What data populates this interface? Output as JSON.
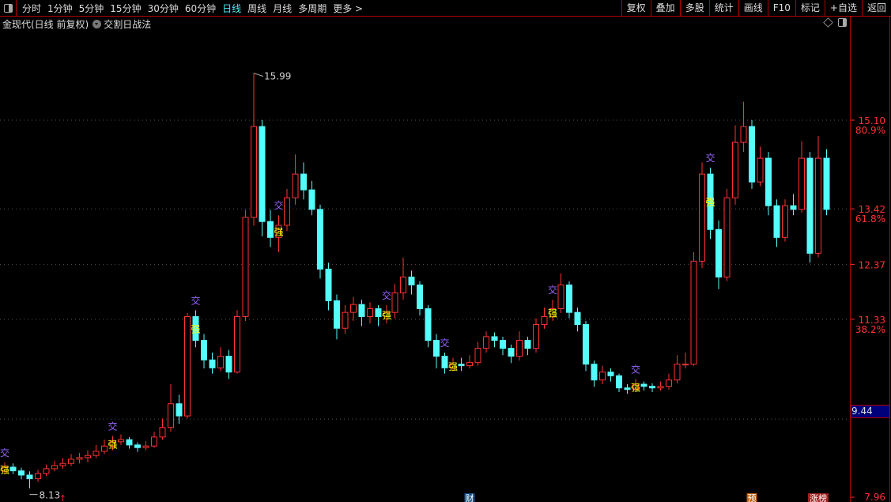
{
  "toolbar": {
    "periods": [
      "分时",
      "1分钟",
      "5分钟",
      "15分钟",
      "30分钟",
      "60分钟",
      "日线",
      "周线",
      "月线",
      "多周期",
      "更多 >"
    ],
    "active_period": "日线",
    "tools": [
      "复权",
      "叠加",
      "多股",
      "统计",
      "画线",
      "F10",
      "标记",
      "+自选",
      "返回"
    ]
  },
  "subbar": {
    "title": "金现代(日线 前复权)",
    "indicator": "交割日战法"
  },
  "colors": {
    "up": "#ff3232",
    "down": "#54fcfc",
    "signal_jiao": "#9966ff",
    "signal_qiang": "#ffff00",
    "axis": "#ff3232",
    "current_box": "#00007a",
    "active": "#4cf0f6"
  },
  "chart_data": {
    "type": "candlestick",
    "ylim": [
      7.96,
      15.99
    ],
    "y_ticks": [
      {
        "price": "15.10",
        "pct": "80.9%"
      },
      {
        "price": "13.42",
        "pct": "61.8%"
      },
      {
        "price": "12.37",
        "pct": ""
      },
      {
        "price": "11.33",
        "pct": "38.2%"
      },
      {
        "price": "7.96",
        "pct": ""
      }
    ],
    "current_price": "9.44",
    "max_label": "15.99",
    "min_label": "8.13",
    "ohlc": [
      [
        8.45,
        8.62,
        8.4,
        8.53
      ],
      [
        8.53,
        8.6,
        8.4,
        8.46
      ],
      [
        8.46,
        8.52,
        8.3,
        8.38
      ],
      [
        8.38,
        8.45,
        8.13,
        8.31
      ],
      [
        8.31,
        8.48,
        8.25,
        8.41
      ],
      [
        8.41,
        8.58,
        8.36,
        8.5
      ],
      [
        8.5,
        8.65,
        8.45,
        8.56
      ],
      [
        8.56,
        8.7,
        8.5,
        8.6
      ],
      [
        8.6,
        8.78,
        8.55,
        8.68
      ],
      [
        8.68,
        8.8,
        8.6,
        8.71
      ],
      [
        8.71,
        8.85,
        8.62,
        8.75
      ],
      [
        8.75,
        8.95,
        8.7,
        8.83
      ],
      [
        8.83,
        9.05,
        8.78,
        8.93
      ],
      [
        8.93,
        9.12,
        8.85,
        9.01
      ],
      [
        9.01,
        9.15,
        8.95,
        9.05
      ],
      [
        9.05,
        9.1,
        8.88,
        8.95
      ],
      [
        8.95,
        9.0,
        8.82,
        8.9
      ],
      [
        8.9,
        9.02,
        8.85,
        8.93
      ],
      [
        8.93,
        9.2,
        8.9,
        9.1
      ],
      [
        9.1,
        9.45,
        9.05,
        9.28
      ],
      [
        9.28,
        10.1,
        9.2,
        9.73
      ],
      [
        9.73,
        9.9,
        9.35,
        9.5
      ],
      [
        9.5,
        11.45,
        9.45,
        11.38
      ],
      [
        11.38,
        11.5,
        10.8,
        10.93
      ],
      [
        10.93,
        11.05,
        10.4,
        10.56
      ],
      [
        10.56,
        10.7,
        10.3,
        10.41
      ],
      [
        10.41,
        10.8,
        10.35,
        10.63
      ],
      [
        10.63,
        10.75,
        10.2,
        10.33
      ],
      [
        10.33,
        11.5,
        10.3,
        11.38
      ],
      [
        11.38,
        13.4,
        11.3,
        13.26
      ],
      [
        13.26,
        15.99,
        13.1,
        14.98
      ],
      [
        14.98,
        15.1,
        12.9,
        13.18
      ],
      [
        13.18,
        13.4,
        12.7,
        12.88
      ],
      [
        12.88,
        13.3,
        12.6,
        13.11
      ],
      [
        13.11,
        13.8,
        13.0,
        13.63
      ],
      [
        13.63,
        14.45,
        13.5,
        14.08
      ],
      [
        14.08,
        14.3,
        13.6,
        13.78
      ],
      [
        13.78,
        13.95,
        13.3,
        13.41
      ],
      [
        13.41,
        13.5,
        12.1,
        12.28
      ],
      [
        12.28,
        12.4,
        11.5,
        11.68
      ],
      [
        11.68,
        11.8,
        10.95,
        11.16
      ],
      [
        11.16,
        11.6,
        11.05,
        11.46
      ],
      [
        11.46,
        11.75,
        11.3,
        11.61
      ],
      [
        11.61,
        11.7,
        11.2,
        11.38
      ],
      [
        11.38,
        11.65,
        11.25,
        11.53
      ],
      [
        11.53,
        11.6,
        11.2,
        11.38
      ],
      [
        11.38,
        11.6,
        11.25,
        11.46
      ],
      [
        11.46,
        12.0,
        11.35,
        11.83
      ],
      [
        11.83,
        12.5,
        11.7,
        12.13
      ],
      [
        12.13,
        12.25,
        11.8,
        11.98
      ],
      [
        11.98,
        12.05,
        11.4,
        11.53
      ],
      [
        11.53,
        11.6,
        10.8,
        10.93
      ],
      [
        10.93,
        11.05,
        10.4,
        10.63
      ],
      [
        10.63,
        10.7,
        10.3,
        10.41
      ],
      [
        10.41,
        10.6,
        10.35,
        10.48
      ],
      [
        10.48,
        10.6,
        10.35,
        10.45
      ],
      [
        10.45,
        10.65,
        10.4,
        10.51
      ],
      [
        10.51,
        10.9,
        10.45,
        10.78
      ],
      [
        10.78,
        11.1,
        10.7,
        11.0
      ],
      [
        11.0,
        11.08,
        10.8,
        10.93
      ],
      [
        10.93,
        11.0,
        10.65,
        10.78
      ],
      [
        10.78,
        10.85,
        10.5,
        10.63
      ],
      [
        10.63,
        11.1,
        10.55,
        10.93
      ],
      [
        10.93,
        11.0,
        10.65,
        10.78
      ],
      [
        10.78,
        11.35,
        10.7,
        11.23
      ],
      [
        11.23,
        11.55,
        11.15,
        11.38
      ],
      [
        11.38,
        11.7,
        11.3,
        11.53
      ],
      [
        11.53,
        12.2,
        11.45,
        11.98
      ],
      [
        11.98,
        12.05,
        11.35,
        11.46
      ],
      [
        11.46,
        11.55,
        11.1,
        11.23
      ],
      [
        11.23,
        11.3,
        10.35,
        10.48
      ],
      [
        10.48,
        10.55,
        10.05,
        10.18
      ],
      [
        10.18,
        10.45,
        10.1,
        10.33
      ],
      [
        10.33,
        10.4,
        10.15,
        10.26
      ],
      [
        10.26,
        10.3,
        9.95,
        10.03
      ],
      [
        10.03,
        10.1,
        9.92,
        10.0
      ],
      [
        10.0,
        10.2,
        9.95,
        10.1
      ],
      [
        10.1,
        10.15,
        9.98,
        10.06
      ],
      [
        10.06,
        10.12,
        9.95,
        10.03
      ],
      [
        10.03,
        10.15,
        9.98,
        10.06
      ],
      [
        10.06,
        10.3,
        10.0,
        10.18
      ],
      [
        10.18,
        10.65,
        10.12,
        10.48
      ],
      [
        10.48,
        10.7,
        10.4,
        10.48
      ],
      [
        10.48,
        12.6,
        10.45,
        12.43
      ],
      [
        12.43,
        14.3,
        12.3,
        14.08
      ],
      [
        14.08,
        14.2,
        12.85,
        13.03
      ],
      [
        13.03,
        13.2,
        11.9,
        12.13
      ],
      [
        12.13,
        13.8,
        12.05,
        13.63
      ],
      [
        13.63,
        15.0,
        13.5,
        14.68
      ],
      [
        14.68,
        15.45,
        14.5,
        14.98
      ],
      [
        14.98,
        15.1,
        13.8,
        13.93
      ],
      [
        13.93,
        14.6,
        13.85,
        14.38
      ],
      [
        14.38,
        14.5,
        13.3,
        13.48
      ],
      [
        13.48,
        13.6,
        12.7,
        12.88
      ],
      [
        12.88,
        13.6,
        12.8,
        13.48
      ],
      [
        13.48,
        13.7,
        13.3,
        13.41
      ],
      [
        13.41,
        14.7,
        13.35,
        14.38
      ],
      [
        14.38,
        14.5,
        12.4,
        12.58
      ],
      [
        12.58,
        14.8,
        12.5,
        14.38
      ],
      [
        14.38,
        14.55,
        13.3,
        13.41
      ]
    ],
    "signals": [
      {
        "index": 0,
        "text": "交",
        "kind": "jiao"
      },
      {
        "index": 0,
        "text": "强",
        "kind": "qiang"
      },
      {
        "index": 13,
        "text": "交",
        "kind": "jiao"
      },
      {
        "index": 13,
        "text": "强",
        "kind": "qiang"
      },
      {
        "index": 23,
        "text": "交",
        "kind": "jiao"
      },
      {
        "index": 23,
        "text": "强",
        "kind": "qiang"
      },
      {
        "index": 33,
        "text": "交",
        "kind": "jiao"
      },
      {
        "index": 33,
        "text": "强",
        "kind": "qiang"
      },
      {
        "index": 46,
        "text": "交",
        "kind": "jiao"
      },
      {
        "index": 46,
        "text": "强",
        "kind": "qiang"
      },
      {
        "index": 53,
        "text": "交",
        "kind": "jiao"
      },
      {
        "index": 54,
        "text": "强",
        "kind": "qiang"
      },
      {
        "index": 66,
        "text": "交",
        "kind": "jiao"
      },
      {
        "index": 66,
        "text": "强",
        "kind": "qiang"
      },
      {
        "index": 76,
        "text": "交",
        "kind": "jiao"
      },
      {
        "index": 76,
        "text": "强",
        "kind": "qiang"
      },
      {
        "index": 85,
        "text": "交",
        "kind": "jiao"
      },
      {
        "index": 85,
        "text": "强",
        "kind": "qiang"
      }
    ],
    "event_markers": [
      {
        "index": 7,
        "text": "↑",
        "color": "#ff2020"
      },
      {
        "index": 56,
        "text": "财",
        "color": "#1a4f8a"
      },
      {
        "index": 90,
        "text": "预",
        "color": "#c06010"
      },
      {
        "index": 98,
        "text": "涨榜",
        "color": "#a02020"
      }
    ]
  }
}
